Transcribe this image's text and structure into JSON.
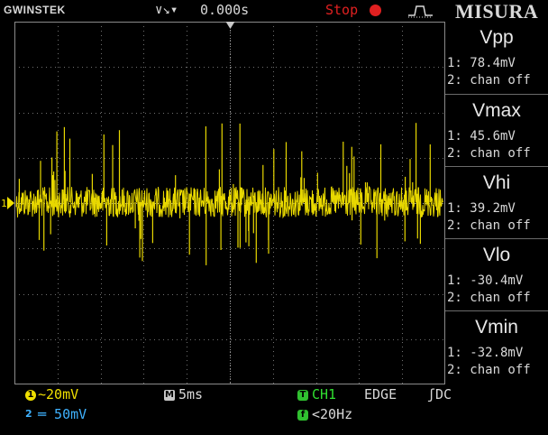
{
  "header": {
    "brand": "GWINSTEK",
    "trigger_arrows": "∨↘▾",
    "time_position": "0.000s",
    "run_status": "Stop",
    "watermark": "MISURA"
  },
  "channel_marker": "1",
  "measurements": [
    {
      "title": "Vpp",
      "ch1": "1: 78.4mV",
      "ch2": "2: chan off"
    },
    {
      "title": "Vmax",
      "ch1": "1: 45.6mV",
      "ch2": "2: chan off"
    },
    {
      "title": "Vhi",
      "ch1": "1: 39.2mV",
      "ch2": "2: chan off"
    },
    {
      "title": "Vlo",
      "ch1": "1: -30.4mV",
      "ch2": "2: chan off"
    },
    {
      "title": "Vmin",
      "ch1": "1: -32.8mV",
      "ch2": "2: chan off"
    }
  ],
  "footer": {
    "ch1_badge": "1",
    "ch1_scale": "∼20mV",
    "ch2_badge": "2",
    "ch2_scale": "═ 50mV",
    "timebase_badge": "M",
    "timebase": "5ms",
    "trigger_badge": "T",
    "trigger_source": "CH1",
    "trigger_type": "EDGE",
    "trigger_coupling": "ʃDC",
    "freq_badge": "f",
    "frequency": "<20Hz"
  },
  "colors": {
    "ch1": "#f0e000",
    "ch2": "#3fb2ff",
    "trigger": "#30e030",
    "stop": "#e02020"
  },
  "icons": {
    "stop": "stop-dot-icon",
    "edge": "rising-edge-icon"
  }
}
